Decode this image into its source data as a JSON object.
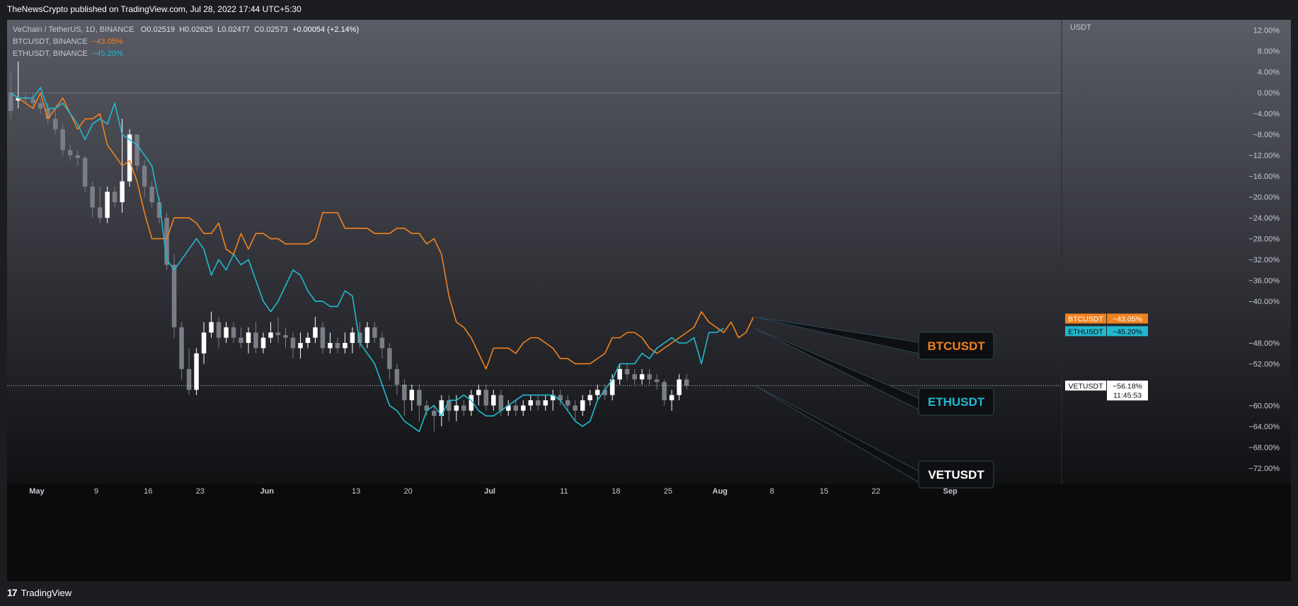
{
  "header": {
    "published": "TheNewsCrypto published on TradingView.com, Jul 28, 2022 17:44 UTC+5:30"
  },
  "legend": {
    "symbol": "VeChain / TetherUS, 1D, BINANCE",
    "o": "O0.02519",
    "h": "H0.02625",
    "l": "L0.02477",
    "c": "C0.02573",
    "change": "+0.00054 (+2.14%)",
    "btc": {
      "label": "BTCUSDT, BINANCE",
      "value": "−43.05%"
    },
    "eth": {
      "label": "ETHUSDT, BINANCE",
      "value": "−45.20%"
    }
  },
  "footer": {
    "brand": "TradingView"
  },
  "colors": {
    "btc": "#f0821e",
    "eth": "#22b8cf",
    "vet_up": "#ffffff",
    "vet_down": "#7b7d86",
    "axis_text": "#d1d4dc"
  },
  "chart_data": {
    "type": "line",
    "axis_unit": "USDT",
    "ylim": [
      -75,
      14
    ],
    "y_ticks": [
      "12.00%",
      "8.00%",
      "4.00%",
      "0.00%",
      "−4.00%",
      "−8.00%",
      "−12.00%",
      "−16.00%",
      "−20.00%",
      "−24.00%",
      "−28.00%",
      "−32.00%",
      "−36.00%",
      "−40.00%",
      "−44.00%",
      "−48.00%",
      "−52.00%",
      "−56.00%",
      "−60.00%",
      "−64.00%",
      "−68.00%",
      "−72.00%"
    ],
    "x_ticks": [
      {
        "label": "May",
        "day": 4
      },
      {
        "label": "9",
        "day": 12
      },
      {
        "label": "16",
        "day": 19
      },
      {
        "label": "23",
        "day": 26
      },
      {
        "label": "Jun",
        "day": 35
      },
      {
        "label": "13",
        "day": 47
      },
      {
        "label": "20",
        "day": 54
      },
      {
        "label": "Jul",
        "day": 65
      },
      {
        "label": "11",
        "day": 75
      },
      {
        "label": "18",
        "day": 82
      },
      {
        "label": "25",
        "day": 89
      },
      {
        "label": "Aug",
        "day": 96
      },
      {
        "label": "8",
        "day": 103
      },
      {
        "label": "15",
        "day": 110
      },
      {
        "label": "22",
        "day": 117
      },
      {
        "label": "Sep",
        "day": 127
      }
    ],
    "series": [
      {
        "name": "BTCUSDT",
        "values": [
          0,
          -1,
          -2,
          -3,
          0,
          -5,
          -3,
          -1,
          -4,
          -7,
          -5,
          -5,
          -4,
          -10,
          -12,
          -14,
          -13,
          -17,
          -23,
          -28,
          -28,
          -28,
          -24,
          -24,
          -24,
          -25,
          -27,
          -27,
          -25,
          -30,
          -31,
          -27,
          -30,
          -27,
          -27,
          -28,
          -28,
          -29,
          -29,
          -29,
          -29,
          -28,
          -23,
          -23,
          -23,
          -26,
          -26,
          -26,
          -26,
          -27,
          -27,
          -27,
          -26,
          -26,
          -27,
          -27,
          -29,
          -28,
          -31,
          -39,
          -44,
          -45,
          -47,
          -50,
          -53,
          -49,
          -49,
          -49,
          -50,
          -48,
          -47,
          -47,
          -48,
          -49,
          -51,
          -51,
          -52,
          -52,
          -52,
          -51,
          -50,
          -47,
          -47,
          -46,
          -46,
          -47,
          -49,
          -50,
          -49,
          -48,
          -47,
          -46,
          -45,
          -42,
          -44,
          -45,
          -46,
          -44,
          -47,
          -46,
          -43.05
        ],
        "color": "#f0821e"
      },
      {
        "name": "ETHUSDT",
        "values": [
          0,
          -1,
          -1,
          -1,
          1,
          -3,
          -3,
          -2,
          -4,
          -6,
          -9,
          -6,
          -5,
          -6,
          -2,
          -8,
          -9,
          -10,
          -12,
          -14,
          -21,
          -32,
          -34,
          -32,
          -30,
          -28,
          -30,
          -35,
          -32,
          -34,
          -31,
          -33,
          -32,
          -36,
          -40,
          -42,
          -40,
          -37,
          -34,
          -35,
          -38,
          -40,
          -40,
          -41,
          -41,
          -38,
          -39,
          -48,
          -50,
          -52,
          -56,
          -60,
          -61,
          -63,
          -64,
          -65,
          -61,
          -60,
          -62,
          -59,
          -59,
          -58,
          -59,
          -61,
          -62,
          -62,
          -61,
          -60,
          -59,
          -58,
          -58,
          -58,
          -58,
          -58,
          -59,
          -61,
          -63,
          -64,
          -63,
          -59,
          -57,
          -55,
          -52,
          -52,
          -52,
          -50,
          -51,
          -49,
          -48,
          -47,
          -48,
          -48,
          -47,
          -52,
          -46,
          -46,
          -45.2
        ],
        "color": "#22b8cf"
      },
      {
        "name": "VETUSDT",
        "type": "candlestick",
        "last": "−56.18%",
        "timer": "11:45:53",
        "candles": [
          [
            0,
            -3.5,
            4,
            -5
          ],
          [
            -1.5,
            -1,
            6,
            -3
          ],
          [
            -1,
            -1.2,
            0,
            -2
          ],
          [
            -1.2,
            -2,
            0,
            -3
          ],
          [
            -2,
            -3,
            -1,
            -4
          ],
          [
            -3,
            -5,
            -2,
            -6
          ],
          [
            -5,
            -7,
            -3,
            -8
          ],
          [
            -7,
            -11,
            -6,
            -12
          ],
          [
            -11,
            -12,
            -10,
            -13
          ],
          [
            -12,
            -12.5,
            -11,
            -14
          ],
          [
            -12.5,
            -18,
            -12,
            -19
          ],
          [
            -18,
            -22,
            -17,
            -24
          ],
          [
            -22,
            -24,
            -18,
            -25
          ],
          [
            -24,
            -19,
            -18,
            -25
          ],
          [
            -19,
            -21,
            -18,
            -22
          ],
          [
            -21,
            -17,
            -5,
            -23
          ],
          [
            -17,
            -8,
            -7,
            -18
          ],
          [
            -8,
            -14,
            -8,
            -15
          ],
          [
            -14,
            -18,
            -13,
            -20
          ],
          [
            -18,
            -21,
            -17,
            -22
          ],
          [
            -21,
            -24,
            -20,
            -25
          ],
          [
            -24,
            -33,
            -23,
            -34
          ],
          [
            -33,
            -45,
            -31,
            -47
          ],
          [
            -45,
            -53,
            -44,
            -55
          ],
          [
            -53,
            -57,
            -49,
            -58
          ],
          [
            -57,
            -50,
            -49,
            -58
          ],
          [
            -50,
            -46,
            -44,
            -52
          ],
          [
            -46,
            -44,
            -42,
            -47
          ],
          [
            -44,
            -47,
            -43,
            -49
          ],
          [
            -47,
            -45,
            -44,
            -48
          ],
          [
            -45,
            -47,
            -44,
            -48
          ],
          [
            -47,
            -48,
            -45,
            -49
          ],
          [
            -48,
            -46,
            -45,
            -50
          ],
          [
            -46,
            -49,
            -44,
            -50
          ],
          [
            -49,
            -47,
            -46,
            -50
          ],
          [
            -47,
            -46,
            -44,
            -48
          ],
          [
            -46,
            -46.5,
            -43,
            -48
          ],
          [
            -46.5,
            -47,
            -45,
            -49
          ],
          [
            -47,
            -49,
            -46,
            -51
          ],
          [
            -49,
            -48,
            -46,
            -51
          ],
          [
            -48,
            -47,
            -46,
            -49
          ],
          [
            -47,
            -45,
            -43,
            -48
          ],
          [
            -45,
            -49,
            -44,
            -50
          ],
          [
            -49,
            -48,
            -46,
            -50
          ],
          [
            -48,
            -49,
            -47,
            -50
          ],
          [
            -49,
            -48,
            -46,
            -50
          ],
          [
            -48,
            -46,
            -45,
            -50
          ],
          [
            -46,
            -48,
            -44,
            -49
          ],
          [
            -48,
            -45,
            -44,
            -49
          ],
          [
            -45,
            -47,
            -44,
            -48
          ],
          [
            -47,
            -49,
            -46,
            -51
          ],
          [
            -49,
            -53,
            -48,
            -55
          ],
          [
            -53,
            -56,
            -52,
            -58
          ],
          [
            -56,
            -59,
            -55,
            -62
          ],
          [
            -59,
            -57,
            -56,
            -61
          ],
          [
            -57,
            -60,
            -56,
            -63
          ],
          [
            -60,
            -61,
            -59,
            -62
          ],
          [
            -61,
            -62,
            -60,
            -65
          ],
          [
            -62,
            -59,
            -58,
            -64
          ],
          [
            -59,
            -61,
            -58,
            -63
          ],
          [
            -61,
            -60,
            -58,
            -63
          ],
          [
            -60,
            -61,
            -59,
            -62
          ],
          [
            -61,
            -58,
            -57,
            -62
          ],
          [
            -58,
            -57,
            -56,
            -60
          ],
          [
            -57,
            -60,
            -56,
            -61
          ],
          [
            -60,
            -58,
            -57,
            -61
          ],
          [
            -58,
            -61,
            -57,
            -62
          ],
          [
            -61,
            -60,
            -59,
            -62
          ],
          [
            -60,
            -61,
            -59,
            -62
          ],
          [
            -61,
            -60,
            -59,
            -62
          ],
          [
            -60,
            -59,
            -58,
            -61
          ],
          [
            -59,
            -60,
            -58,
            -61
          ],
          [
            -60,
            -59,
            -58,
            -61
          ],
          [
            -59,
            -58,
            -57,
            -61
          ],
          [
            -58,
            -59,
            -57,
            -60
          ],
          [
            -59,
            -60,
            -58,
            -61
          ],
          [
            -60,
            -61,
            -59,
            -63
          ],
          [
            -61,
            -59,
            -58,
            -62
          ],
          [
            -59,
            -58,
            -57,
            -60
          ],
          [
            -58,
            -57,
            -56,
            -59
          ],
          [
            -57,
            -58,
            -56,
            -59
          ],
          [
            -58,
            -55,
            -54,
            -59
          ],
          [
            -55,
            -53,
            -52,
            -56
          ],
          [
            -53,
            -54,
            -52,
            -55
          ],
          [
            -54,
            -55,
            -53,
            -56
          ],
          [
            -55,
            -54,
            -53,
            -56
          ],
          [
            -54,
            -55,
            -53,
            -56
          ],
          [
            -55,
            -55.5,
            -54,
            -57
          ],
          [
            -55.5,
            -59,
            -55,
            -60
          ],
          [
            -59,
            -58,
            -57,
            -61
          ],
          [
            -58,
            -55,
            -54,
            -59
          ],
          [
            -55,
            -56.18,
            -54,
            -57
          ]
        ]
      }
    ],
    "x_start_day": 0,
    "x_end_day": 142
  },
  "labels": {
    "btc_callout": "BTCUSDT",
    "eth_callout": "ETHUSDT",
    "vet_callout": "VETUSDT",
    "btc_tag": "BTCUSDT",
    "eth_tag": "ETHUSDT",
    "vet_tag": "VETUSDT"
  }
}
